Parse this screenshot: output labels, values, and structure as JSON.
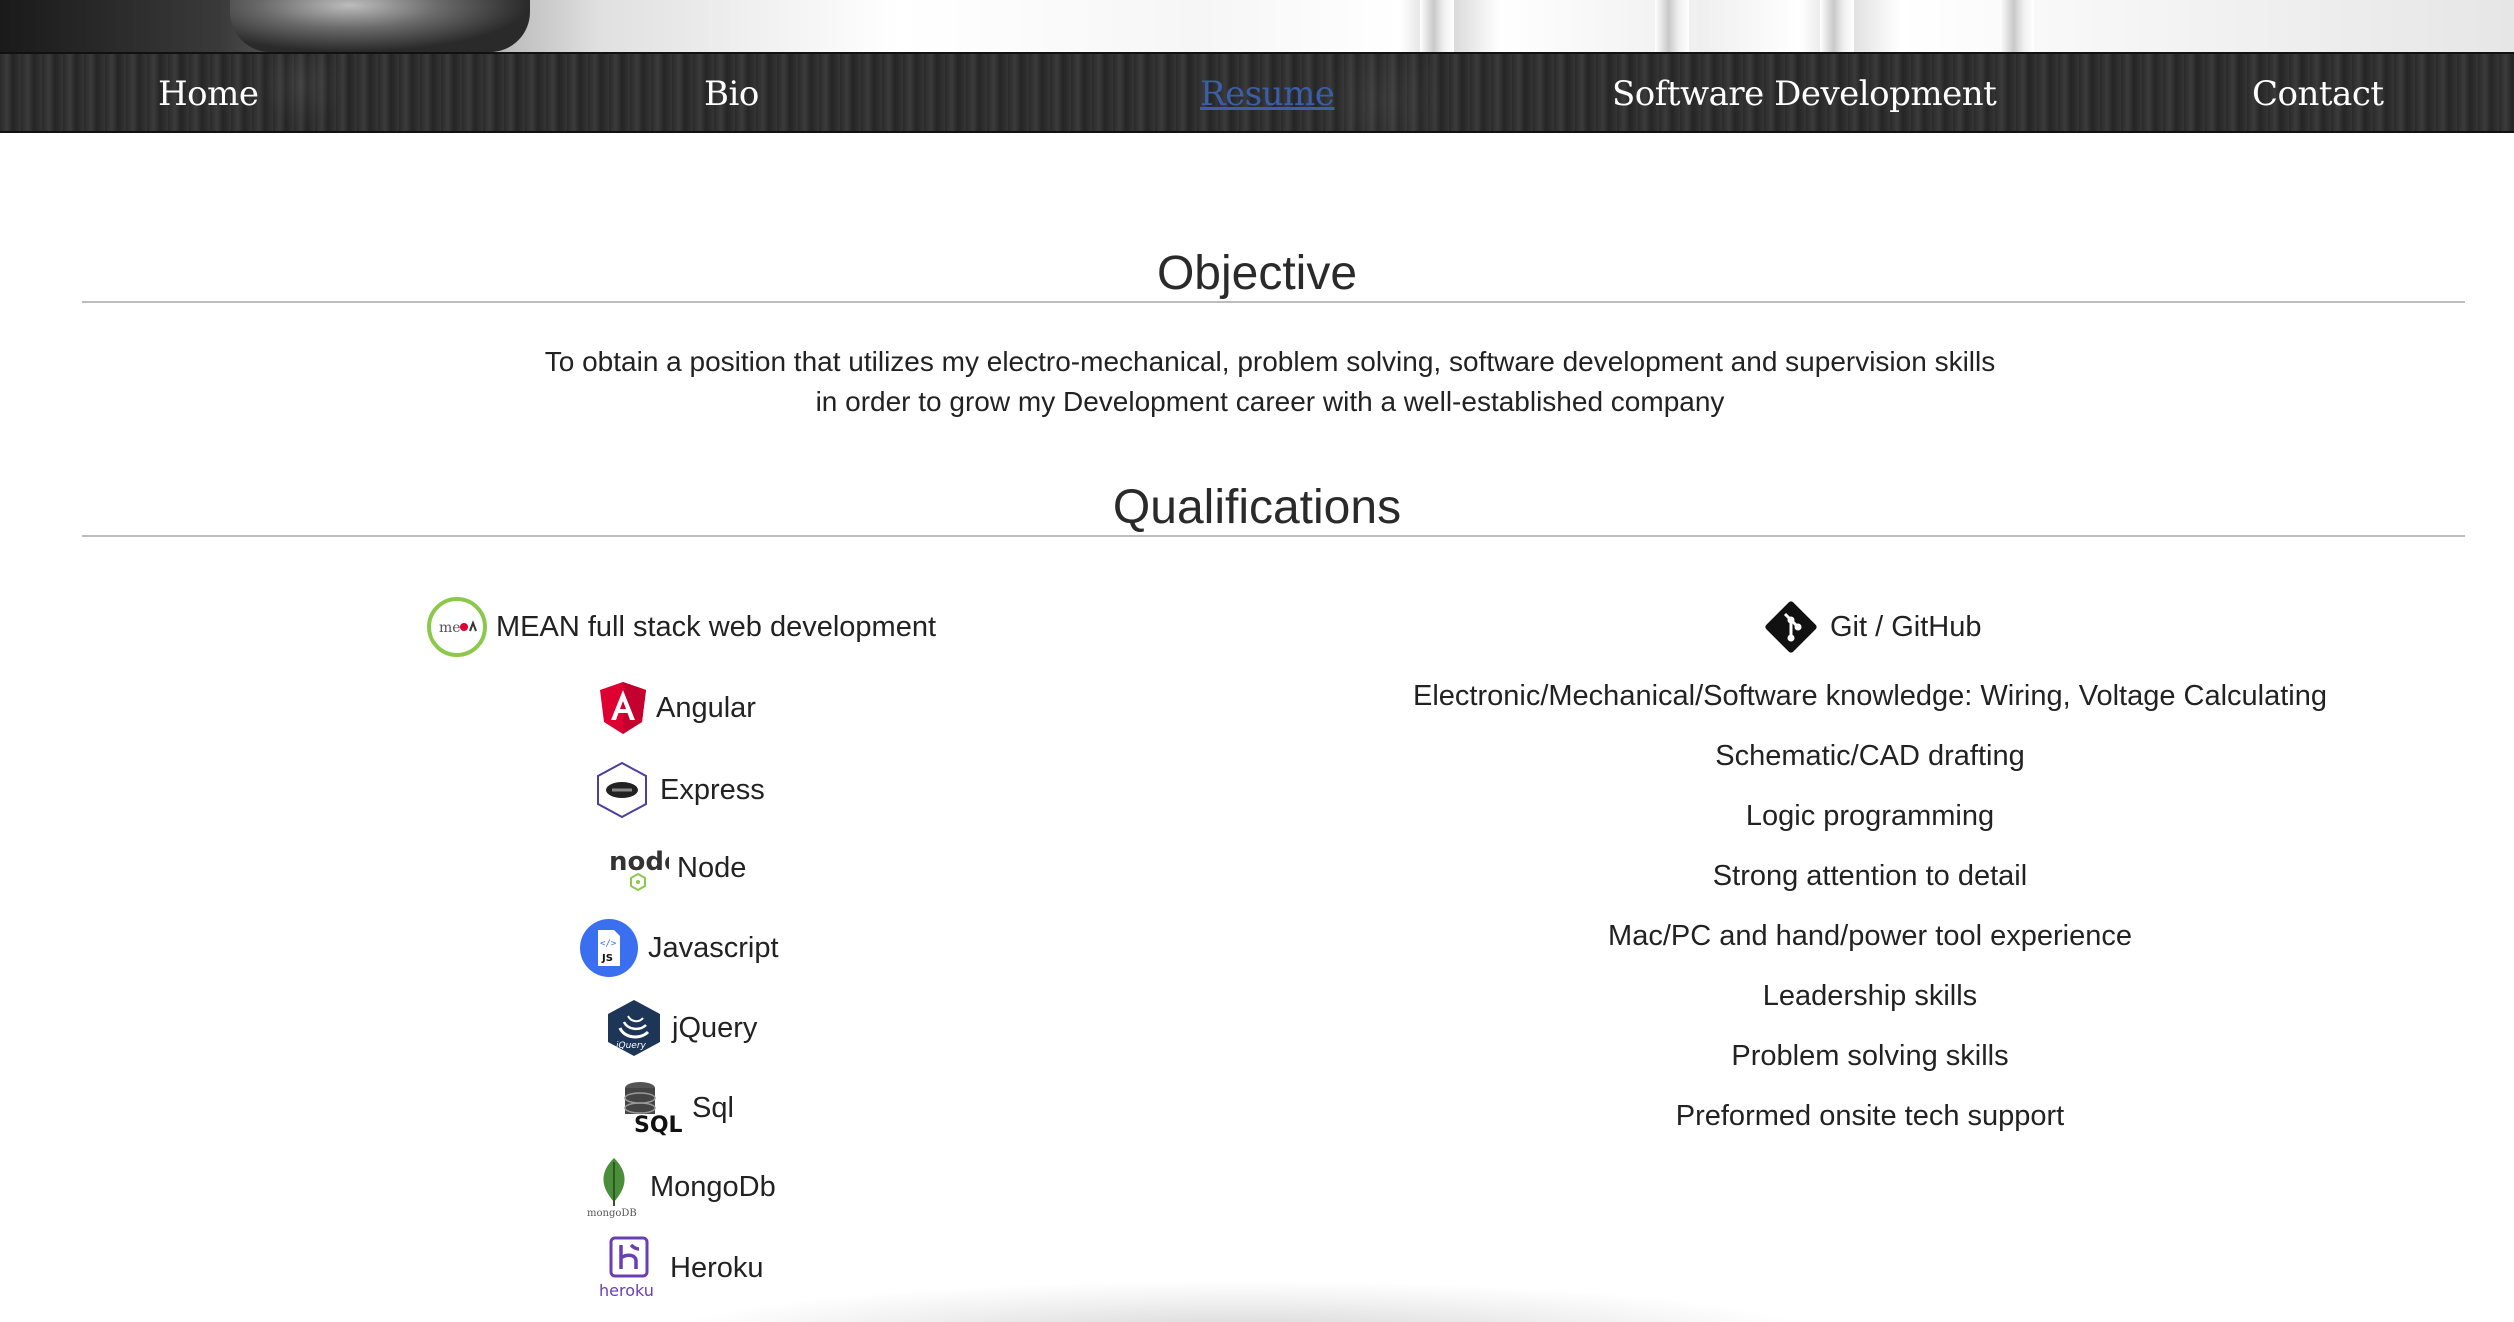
{
  "nav": {
    "items": [
      {
        "label": "Home"
      },
      {
        "label": "Bio"
      },
      {
        "label": "Resume",
        "active": true
      },
      {
        "label": "Software Development"
      },
      {
        "label": "Contact"
      }
    ]
  },
  "objective": {
    "title": "Objective",
    "line1": "To obtain a position that utilizes my electro-mechanical, problem solving, software development and supervision skills",
    "line2": "in order to grow my Development career with a well-established company"
  },
  "qualifications": {
    "title": "Qualifications",
    "left": [
      {
        "label": "MEAN full stack web development",
        "icon": "mean-icon"
      },
      {
        "label": "Angular",
        "icon": "angular-icon"
      },
      {
        "label": "Express",
        "icon": "express-icon"
      },
      {
        "label": "Node",
        "icon": "node-icon"
      },
      {
        "label": "Javascript",
        "icon": "javascript-icon"
      },
      {
        "label": "jQuery",
        "icon": "jquery-icon"
      },
      {
        "label": "Sql",
        "icon": "sql-icon"
      },
      {
        "label": "MongoDb",
        "icon": "mongodb-icon"
      },
      {
        "label": "Heroku",
        "icon": "heroku-icon"
      }
    ],
    "right": [
      {
        "label": "Git / GitHub",
        "icon": "git-icon"
      },
      {
        "label": "Electronic/Mechanical/Software knowledge: Wiring, Voltage Calculating"
      },
      {
        "label": "Schematic/CAD drafting"
      },
      {
        "label": "Logic programming"
      },
      {
        "label": "Strong attention to detail"
      },
      {
        "label": "Mac/PC and hand/power tool experience"
      },
      {
        "label": "Leadership skills"
      },
      {
        "label": "Problem solving skills"
      },
      {
        "label": "Preformed onsite tech support"
      }
    ],
    "icon_text": {
      "mean": "me",
      "node": "node",
      "javascript": "JS",
      "sql": "SQL",
      "jquery": "jQuery",
      "mongodb": "mongoDB",
      "heroku": "heroku"
    }
  },
  "colors": {
    "nav_text": "#ffffff",
    "nav_active": "#3a5fa8",
    "angular": "#dd0031",
    "mean_ring": "#8cc84b",
    "javascript": "#3a6ff0",
    "jquery": "#1d3557",
    "mongodb_leaf": "#4a8d3a",
    "heroku": "#6a3fb4"
  }
}
